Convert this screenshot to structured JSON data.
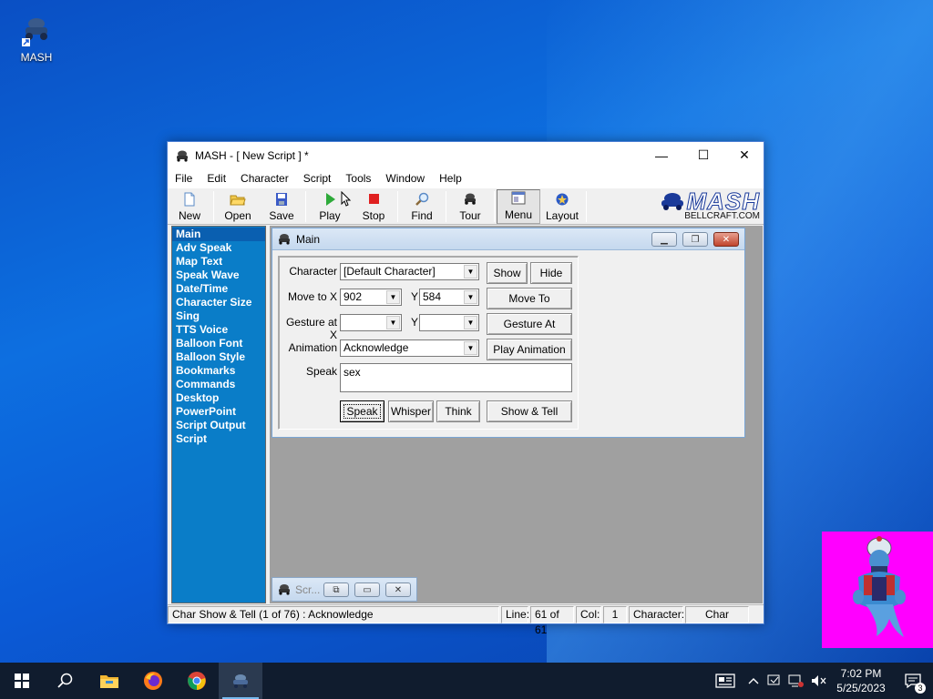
{
  "desktop": {
    "icons": [
      {
        "label": "MASH",
        "icon": "mash-shortcut-icon"
      }
    ]
  },
  "window": {
    "title": "MASH - [ New Script ] *",
    "controls": {
      "minimize": "—",
      "maximize": "☐",
      "close": "✕"
    },
    "menu": [
      "File",
      "Edit",
      "Character",
      "Script",
      "Tools",
      "Window",
      "Help"
    ],
    "toolbar": {
      "new": "New",
      "open": "Open",
      "save": "Save",
      "play": "Play",
      "stop": "Stop",
      "find": "Find",
      "tour": "Tour",
      "menu": "Menu",
      "layout": "Layout"
    },
    "logo": {
      "brand": "MASH",
      "site": "BELLCRAFT.COM"
    }
  },
  "sidebar": {
    "items": [
      "Main",
      "Adv Speak",
      "Map Text",
      "Speak Wave",
      "Date/Time",
      "Character Size",
      "Sing",
      "TTS Voice",
      "Balloon Font",
      "Balloon Style",
      "Bookmarks",
      "Commands",
      "Desktop",
      "PowerPoint",
      "Script Output",
      "Script"
    ],
    "selected": "Main"
  },
  "main_panel": {
    "title": "Main",
    "character_label": "Character",
    "character_value": "[Default Character]",
    "show_button": "Show",
    "hide_button": "Hide",
    "moveto_label": "Move to X",
    "moveto_x": "902",
    "y_label": "Y",
    "moveto_y": "584",
    "moveto_button": "Move To",
    "gesture_label": "Gesture at X",
    "gesture_x": "",
    "gesture_y": "",
    "gesture_button": "Gesture At",
    "animation_label": "Animation",
    "animation_value": "Acknowledge",
    "play_animation_button": "Play Animation",
    "speak_label": "Speak",
    "speak_text": "sex",
    "speak_button": "Speak",
    "whisper_button": "Whisper",
    "think_button": "Think",
    "show_tell_button": "Show & Tell"
  },
  "minimized_child": {
    "title": "Scr..."
  },
  "statusbar": {
    "message": "Char Show & Tell (1 of 76) : Acknowledge",
    "line_label": "Line:",
    "line_value": "61 of 61",
    "col_label": "Col:",
    "col_value": "1",
    "char_label": "Character:",
    "char_value": "Char"
  },
  "taskbar": {
    "time": "7:02 PM",
    "date": "5/25/2023",
    "notification_count": "3"
  },
  "colors": {
    "sidebar_bg": "#0a7dc8",
    "genie_bg": "#ff00ff",
    "taskbar_bg": "#101c2e"
  }
}
